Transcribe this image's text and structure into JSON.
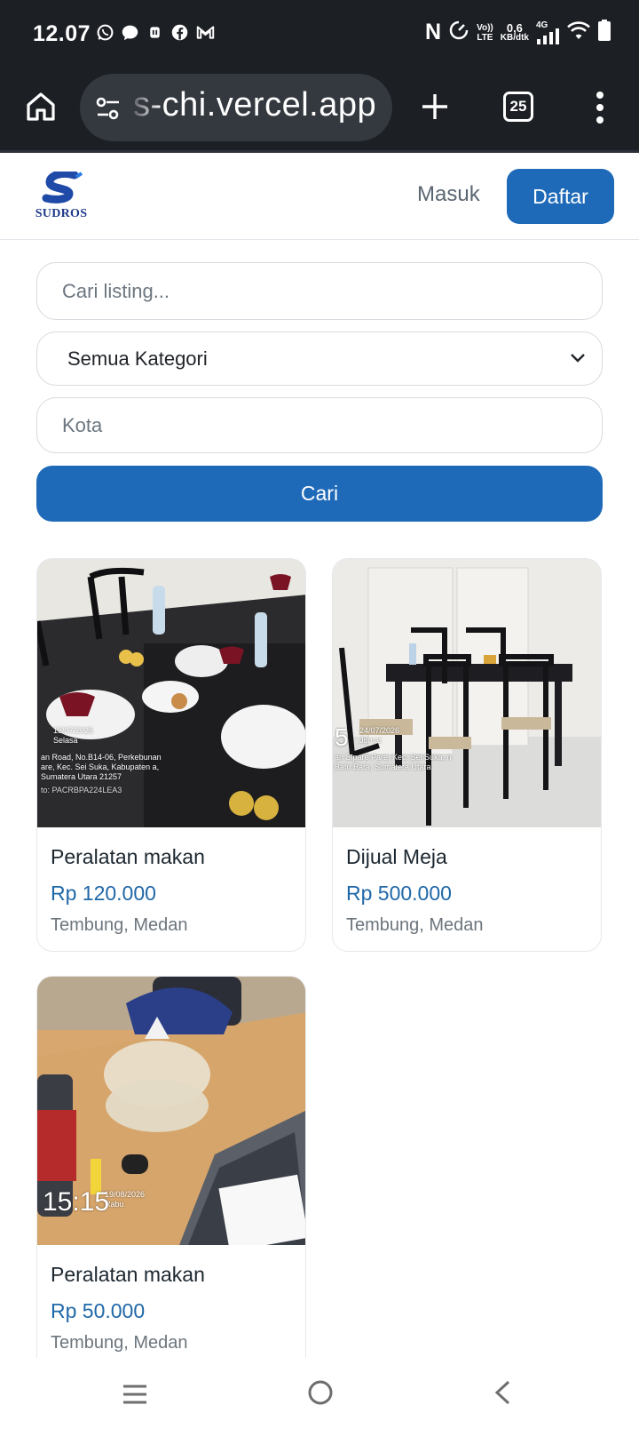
{
  "status_bar": {
    "time": "12.07",
    "notification_icons": [
      "whatsapp-icon",
      "message-icon",
      "app-icon",
      "facebook-icon",
      "gmail-icon"
    ],
    "nfc_label": "N",
    "volte_line1": "Vo))",
    "volte_line2": "LTE",
    "speed_value": "0,6",
    "speed_unit": "KB/dtk",
    "network": "4G"
  },
  "browser": {
    "url": "s-chi.vercel.app",
    "tab_count": "25"
  },
  "header": {
    "logo_text": "SUDROS",
    "login_label": "Masuk",
    "register_label": "Daftar",
    "brand_color": "#1f6ab8"
  },
  "search": {
    "query_placeholder": "Cari listing...",
    "category_selected": "Semua Kategori",
    "city_placeholder": "Kota",
    "submit_label": "Cari"
  },
  "listings": [
    {
      "title": "Peralatan makan",
      "price": "Rp 120.000",
      "location": "Tembung, Medan",
      "photo_stamp_date": "15/07/2025",
      "photo_stamp_day": "Selasa",
      "photo_stamp_address": "an Road, No.B14-06, Perkebunan are, Kec. Sei Suka, Kabupaten a, Sumatera Utara 21257",
      "photo_stamp_code": "to: PACRBPA224LEA3"
    },
    {
      "title": "Dijual Meja",
      "price": "Rp 500.000",
      "location": "Tembung, Medan",
      "photo_stamp_hour": "5",
      "photo_stamp_date": "24/07/2026",
      "photo_stamp_day": "Jumat",
      "photo_stamp_address": "an Sipare Pare, Kec. Sei Suka, n Batu Bara, Sumatera Utara"
    },
    {
      "title": "Peralatan makan",
      "price": "Rp 50.000",
      "location": "Tembung, Medan",
      "photo_stamp_hour": "15:15",
      "photo_stamp_date": "19/08/2026",
      "photo_stamp_day": "Rabu"
    }
  ],
  "nav": {
    "icons": [
      "recents-icon",
      "home-icon",
      "back-icon"
    ]
  }
}
